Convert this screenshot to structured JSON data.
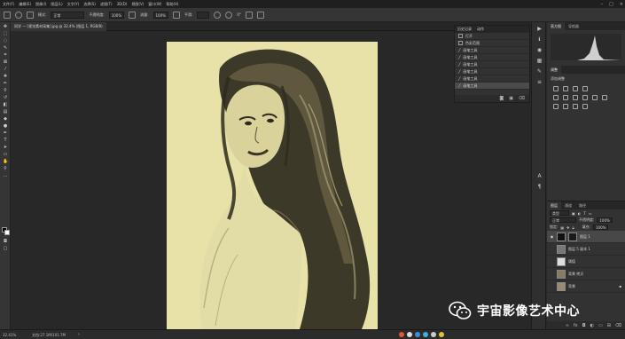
{
  "menubar": {
    "items": [
      "文件(F)",
      "编辑(E)",
      "图像(I)",
      "图层(L)",
      "文字(Y)",
      "选择(S)",
      "滤镜(T)",
      "3D(D)",
      "视图(V)",
      "窗口(W)",
      "帮助(H)"
    ]
  },
  "options": {
    "mode_label": "模式:",
    "mode_value": "正常",
    "opacity_label": "不透明度:",
    "opacity_value": "100%",
    "flow_label": "流量:",
    "flow_value": "100%",
    "smooth_label": "平滑:",
    "angle_value": "0°"
  },
  "document": {
    "tab_title": "同学 — [视觉素材采集].jpg @ 32.4% (图层 1, RGB/8)"
  },
  "history": {
    "tabs": [
      "历史记录",
      "动作"
    ],
    "rows": [
      "打开",
      "色彩范围",
      "画笔工具",
      "画笔工具",
      "画笔工具",
      "画笔工具",
      "画笔工具",
      "画笔工具"
    ],
    "selected_index": 7
  },
  "right_panels": {
    "top_tabs": [
      "直方图",
      "导航器"
    ],
    "adjust_tabs": [
      "调整"
    ],
    "adjust_title": "添加调整",
    "layer_tabs": [
      "图层",
      "通道",
      "路径"
    ],
    "filter_label": "类型",
    "blend_mode": "正常",
    "opacity_label": "不透明度:",
    "opacity_value": "100%",
    "lock_label": "锁定:",
    "fill_label": "填充:",
    "fill_value": "100%",
    "layers": [
      {
        "name": "图层 1",
        "selected": true
      },
      {
        "name": "图层 5 副本 1",
        "selected": false
      },
      {
        "name": "阈值",
        "selected": false
      },
      {
        "name": "背景 拷贝",
        "selected": false
      },
      {
        "name": "背景",
        "selected": false
      }
    ]
  },
  "statusbar": {
    "zoom": "32.41%",
    "doc": "文档:27.1M/101.7M"
  },
  "watermark": {
    "text": "宇宙影像艺术中心"
  },
  "colors": {
    "canvas_bg": "#e8e2a8",
    "ui_dark": "#282828",
    "panel": "#323232"
  }
}
